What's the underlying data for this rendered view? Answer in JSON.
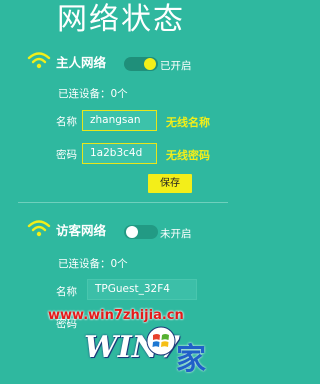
{
  "page": {
    "title": "网络状态"
  },
  "host_network": {
    "title": "主人网络",
    "toggle_on": true,
    "status": "已开启",
    "connected": "已连设备：0个",
    "name_label": "名称",
    "name_value": "zhangsan",
    "name_annotation": "无线名称",
    "password_label": "密码",
    "password_value": "1a2b3c4d",
    "password_annotation": "无线密码",
    "save_label": "保存"
  },
  "guest_network": {
    "title": "访客网络",
    "toggle_on": false,
    "status": "未开启",
    "connected": "已连设备：0个",
    "name_label": "名称",
    "name_value": "TPGuest_32F4",
    "password_label": "密码"
  },
  "watermark": {
    "url": "www.win7zhijia.cn",
    "logo_text": "WIN7",
    "logo_char": "家"
  },
  "colors": {
    "background": "#2fb89f",
    "accent_yellow": "#f2ef19",
    "text": "#ffffff"
  },
  "icons": {
    "network_icon": "wifi-icon",
    "logo_icon": "windows-flag-icon"
  }
}
